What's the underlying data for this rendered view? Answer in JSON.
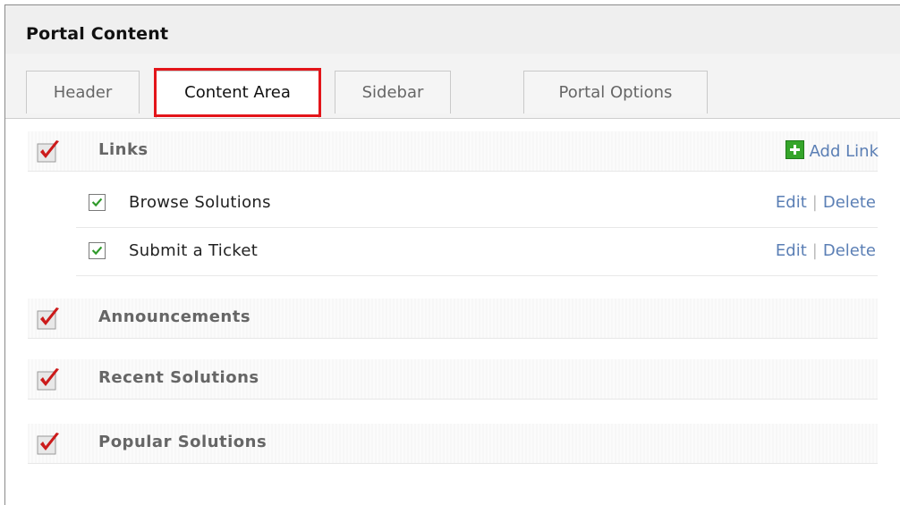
{
  "panel": {
    "title": "Portal Content"
  },
  "tabs": [
    {
      "label": "Header",
      "active": false
    },
    {
      "label": "Content Area",
      "active": true
    },
    {
      "label": "Sidebar",
      "active": false
    },
    {
      "label": "Portal Options",
      "active": false
    }
  ],
  "sections": {
    "links": {
      "label": "Links",
      "checked": true,
      "add_label": "Add Link",
      "items": [
        {
          "label": "Browse Solutions",
          "checked": true,
          "edit": "Edit",
          "delete": "Delete"
        },
        {
          "label": "Submit a Ticket",
          "checked": true,
          "edit": "Edit",
          "delete": "Delete"
        }
      ]
    },
    "announcements": {
      "label": "Announcements",
      "checked": true
    },
    "recent_solutions": {
      "label": "Recent Solutions",
      "checked": true
    },
    "popular_solutions": {
      "label": "Popular Solutions",
      "checked": true
    }
  },
  "separator": "|",
  "colors": {
    "accent_link": "#5b7fb5",
    "active_tab_outline": "#e3151a",
    "add_icon_green": "#35a52a",
    "check_red": "#cc1b1b",
    "small_check_green": "#2f9a2a"
  },
  "icons": {
    "section_check": "red-checkmark-icon",
    "item_check": "checkbox-checked-icon",
    "add": "add-plus-icon"
  }
}
